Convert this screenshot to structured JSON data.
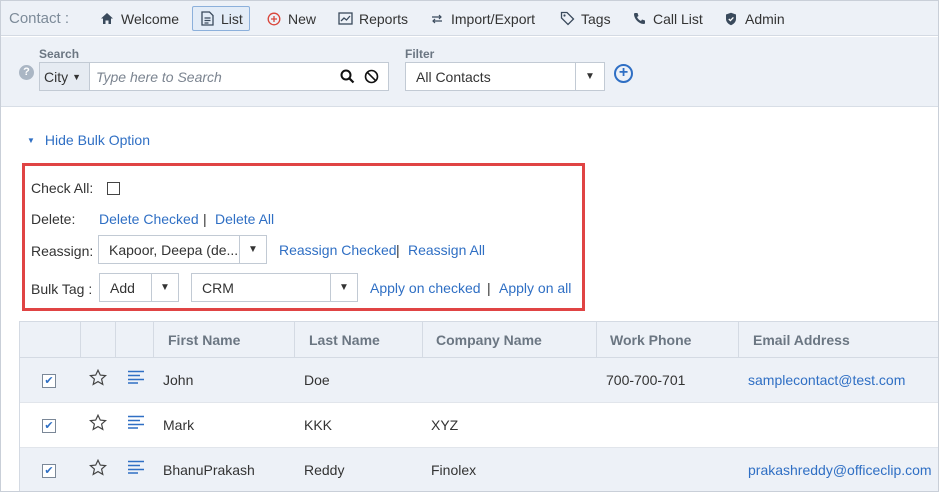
{
  "nav": {
    "brand": "Contact :",
    "items": [
      {
        "label": "Welcome",
        "icon": "home-icon"
      },
      {
        "label": "List",
        "icon": "document-icon"
      },
      {
        "label": "New",
        "icon": "plus-circle-icon"
      },
      {
        "label": "Reports",
        "icon": "chart-icon"
      },
      {
        "label": "Import/Export",
        "icon": "arrows-icon"
      },
      {
        "label": "Tags",
        "icon": "tag-icon"
      },
      {
        "label": "Call List",
        "icon": "phone-icon"
      },
      {
        "label": "Admin",
        "icon": "shield-icon"
      }
    ],
    "active": "List"
  },
  "search": {
    "label": "Search",
    "field": "City",
    "placeholder": "Type here to Search"
  },
  "filter": {
    "label": "Filter",
    "value": "All Contacts"
  },
  "bulk": {
    "toggle_label": "Hide Bulk Option",
    "check_all_label": "Check All:",
    "delete_label": "Delete:",
    "delete_checked": "Delete Checked",
    "delete_all": "Delete All",
    "reassign_label": "Reassign:",
    "reassign_value": "Kapoor, Deepa (de...",
    "reassign_checked": "Reassign Checked",
    "reassign_all": "Reassign All",
    "bulktag_label": "Bulk Tag :",
    "bulktag_action": "Add",
    "bulktag_tag": "CRM",
    "apply_checked": "Apply on checked",
    "apply_all": "Apply on all",
    "separator": "|"
  },
  "table": {
    "columns": [
      "First Name",
      "Last Name",
      "Company Name",
      "Work Phone",
      "Email Address"
    ],
    "rows": [
      {
        "checked": true,
        "first": "John",
        "last": "Doe",
        "company": "",
        "phone": "700-700-701",
        "email": "samplecontact@test.com"
      },
      {
        "checked": true,
        "first": "Mark",
        "last": "KKK",
        "company": "XYZ",
        "phone": "",
        "email": ""
      },
      {
        "checked": true,
        "first": "BhanuPrakash",
        "last": "Reddy",
        "company": "Finolex",
        "phone": "",
        "email": "prakashreddy@officeclip.com"
      }
    ]
  },
  "colors": {
    "accent": "#2f6fc4",
    "highlight_border": "#e04444",
    "header_bg": "#edf1f7"
  }
}
